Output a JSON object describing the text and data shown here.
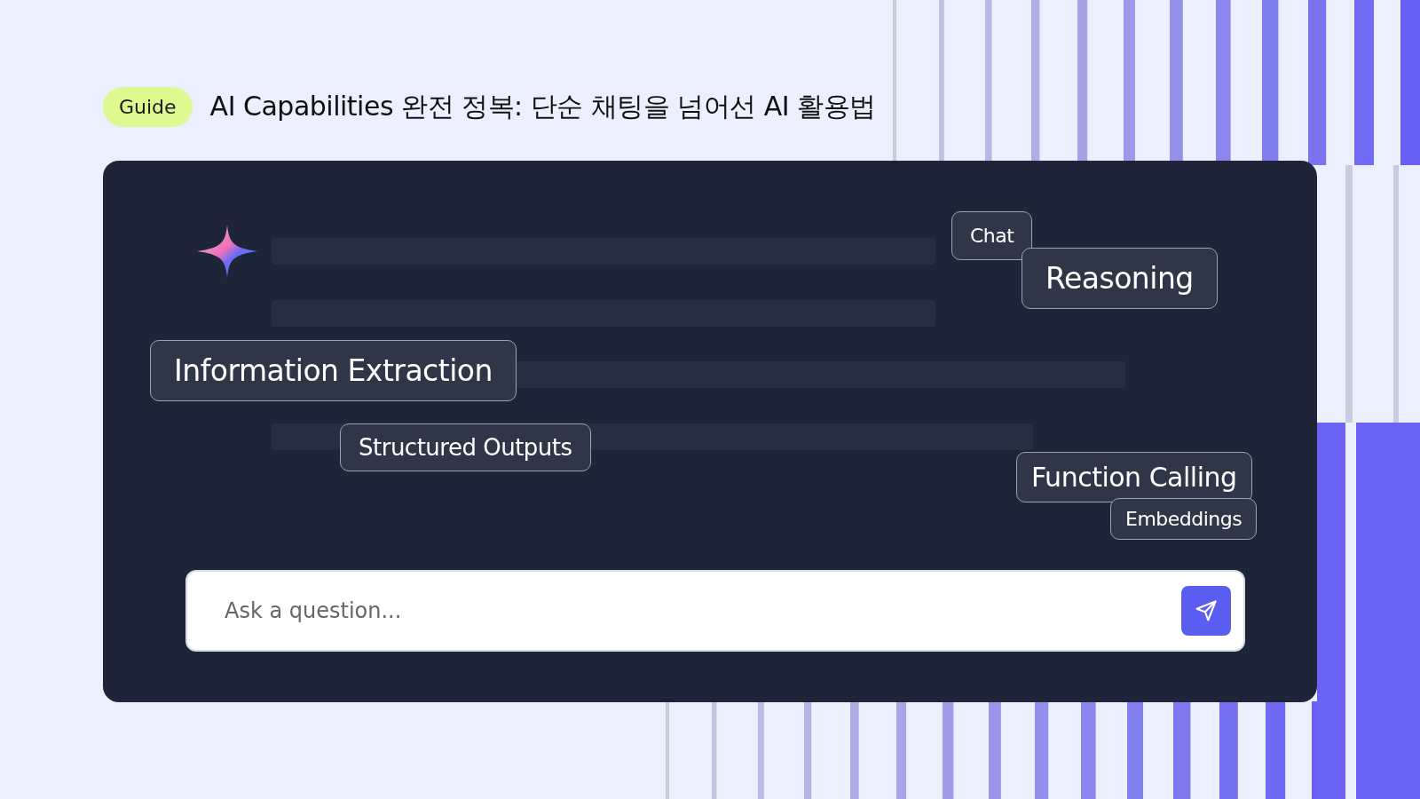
{
  "header": {
    "badge": "Guide",
    "title": "AI Capabilities 완전 정복: 단순 채팅을 넘어선 AI 활용법"
  },
  "chips": [
    {
      "label": "Chat"
    },
    {
      "label": "Reasoning"
    },
    {
      "label": "Information Extraction"
    },
    {
      "label": "Structured Outputs"
    },
    {
      "label": "Function Calling"
    },
    {
      "label": "Embeddings"
    }
  ],
  "composer": {
    "placeholder": "Ask a question..."
  }
}
